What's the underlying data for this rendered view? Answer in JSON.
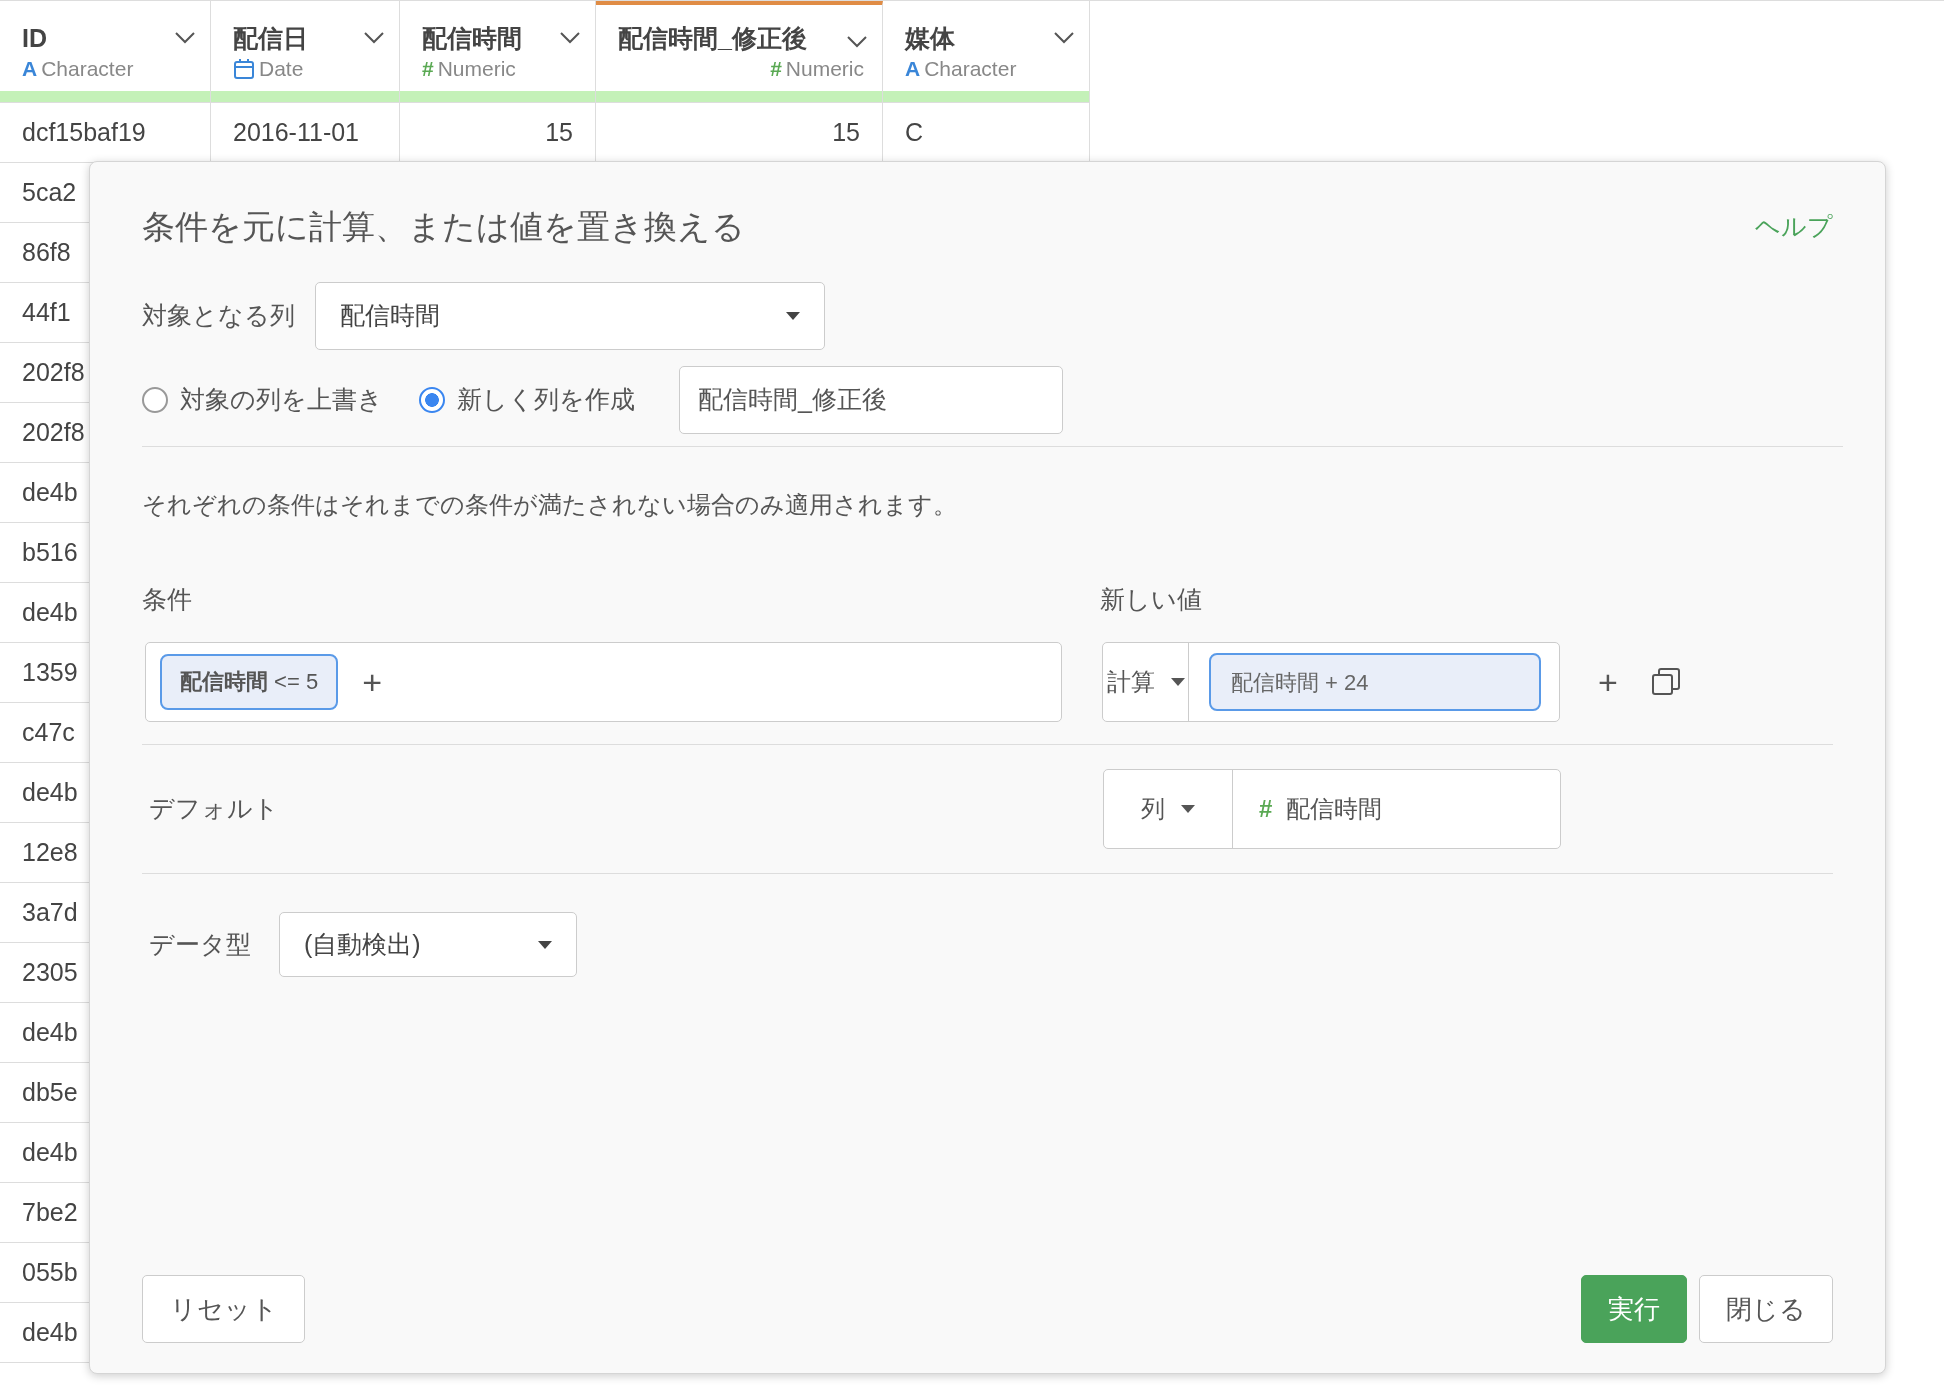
{
  "table": {
    "columns": [
      {
        "name": "ID",
        "type_label": "Character",
        "kind": "character",
        "type_icon": "A",
        "selected": false
      },
      {
        "name": "配信日",
        "type_label": "Date",
        "kind": "date",
        "selected": false
      },
      {
        "name": "配信時間",
        "type_label": "Numeric",
        "kind": "numeric",
        "type_icon": "#",
        "selected": false
      },
      {
        "name": "配信時間_修正後",
        "type_label": "Numeric",
        "kind": "numeric",
        "type_icon": "#",
        "selected": true
      },
      {
        "name": "媒体",
        "type_label": "Character",
        "kind": "character",
        "type_icon": "A",
        "selected": false
      }
    ],
    "rows": [
      [
        "dcf15baf19",
        "2016-11-01",
        "15",
        "15",
        "C"
      ]
    ],
    "ids_under_dialog": [
      "5ca2",
      "86f8",
      "44f1",
      "202f8",
      "202f8",
      "de4b",
      "b516",
      "de4b",
      "1359",
      "c47c",
      "de4b",
      "12e8",
      "3a7d",
      "2305",
      "de4b",
      "db5e",
      "de4b",
      "7be2",
      "055b",
      "de4b"
    ]
  },
  "dialog": {
    "title": "条件を元に計算、または値を置き換える",
    "help_link": "ヘルプ",
    "target_column": {
      "label": "対象となる列",
      "value": "配信時間"
    },
    "modes": [
      {
        "label": "対象の列を上書き",
        "selected": false
      },
      {
        "label": "新しく列を作成",
        "selected": true
      }
    ],
    "new_column_name": "配信時間_修正後",
    "note": "それぞれの条件はそれまでの条件が満たされない場合のみ適用されます。",
    "conditions_header": "条件",
    "new_value_header": "新しい値",
    "conditions": [
      {
        "chips": [
          "**配信時間** <= 5"
        ],
        "add": "+",
        "value_type": "計算",
        "value": "配信時間 + 24",
        "add_row": "+"
      }
    ],
    "default": {
      "label": "デフォルト",
      "value_type": "列",
      "icon": "#",
      "value": "配信時間"
    },
    "data_type": {
      "label": "データ型",
      "value": "(自動検出)"
    },
    "buttons": {
      "reset": "リセット",
      "run": "実行",
      "close": "閉じる"
    }
  }
}
